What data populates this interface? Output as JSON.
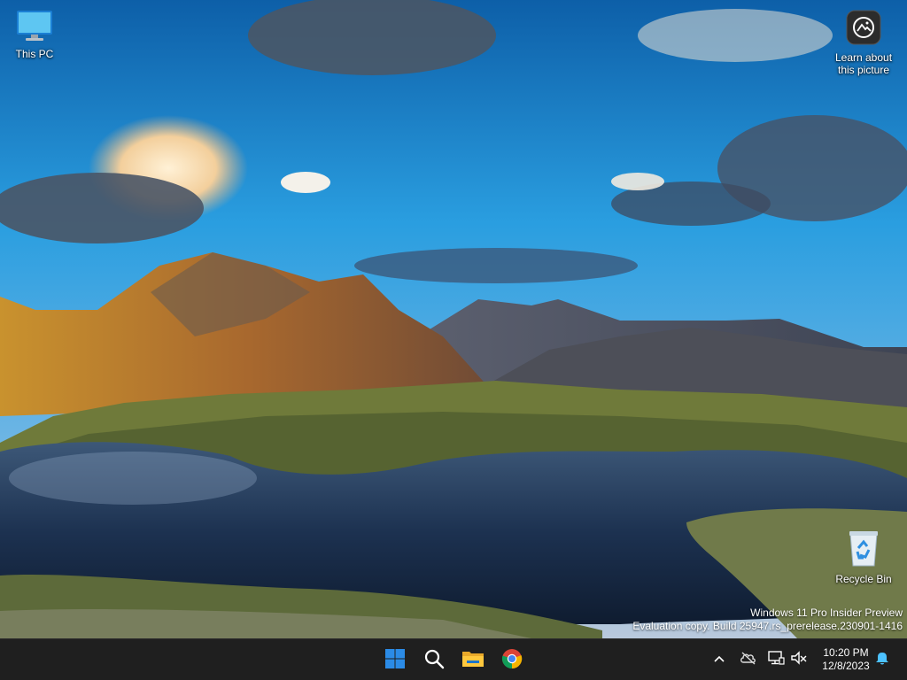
{
  "desktop": {
    "icons": [
      {
        "id": "this-pc",
        "label": "This PC",
        "icon": "monitor-icon"
      },
      {
        "id": "learn-picture",
        "label_line1": "Learn about",
        "label_line2": "this picture",
        "icon": "camera-info-icon"
      },
      {
        "id": "recycle-bin",
        "label": "Recycle Bin",
        "icon": "recycle-bin-icon"
      }
    ],
    "watermark": {
      "line1": "Windows 11 Pro Insider Preview",
      "line2": "Evaluation copy. Build 25947.rs_prerelease.230901-1416"
    }
  },
  "taskbar": {
    "pinned": [
      {
        "name": "Start",
        "icon": "windows-logo-icon"
      },
      {
        "name": "Search",
        "icon": "search-icon"
      },
      {
        "name": "File Explorer",
        "icon": "folder-icon"
      },
      {
        "name": "Google Chrome",
        "icon": "chrome-icon"
      }
    ],
    "tray": {
      "icons": [
        "chevron-up-icon",
        "onedrive-offline-icon",
        "network-icon",
        "volume-muted-icon",
        "bell-icon"
      ],
      "time": "10:20 PM",
      "date": "12/8/2023"
    }
  },
  "colors": {
    "taskbar_bg": "#1f1f1f",
    "windows_blue": "#2b8be6",
    "accent": "#4cc2ff"
  }
}
